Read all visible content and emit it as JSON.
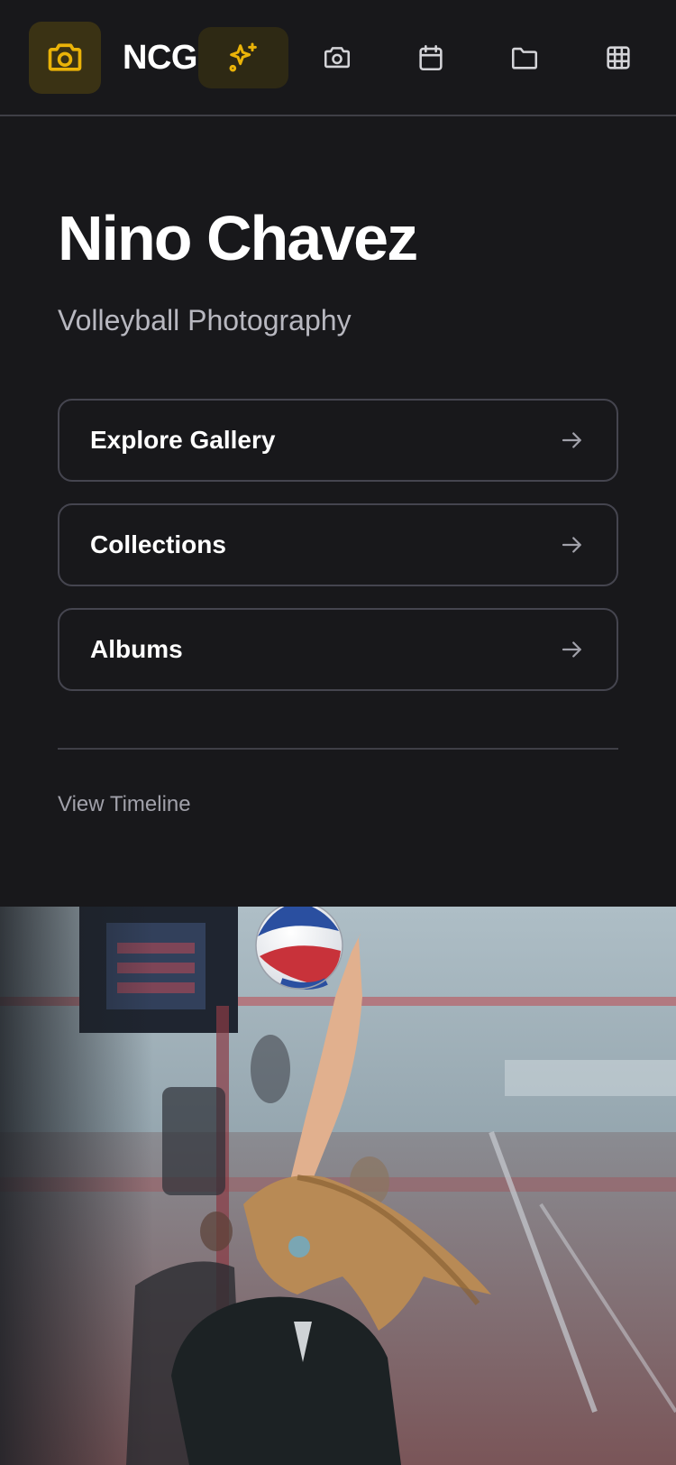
{
  "nav": {
    "brand": "NCG",
    "logo_icon": "camera-icon",
    "items": [
      {
        "name": "sparkles-icon",
        "active": true
      },
      {
        "name": "camera-icon",
        "active": false
      },
      {
        "name": "calendar-icon",
        "active": false
      },
      {
        "name": "folder-icon",
        "active": false
      },
      {
        "name": "grid-icon",
        "active": false
      }
    ]
  },
  "hero": {
    "title": "Nino Chavez",
    "subtitle": "Volleyball Photography"
  },
  "menu": {
    "items": [
      {
        "label": "Explore Gallery",
        "icon": "arrow-right-icon"
      },
      {
        "label": "Collections",
        "icon": "arrow-right-icon"
      },
      {
        "label": "Albums",
        "icon": "arrow-right-icon"
      }
    ],
    "timeline_label": "View Timeline"
  },
  "colors": {
    "background": "#18181b",
    "accent": "#eab308",
    "border": "#45454f",
    "muted_text": "#a1a1aa"
  }
}
